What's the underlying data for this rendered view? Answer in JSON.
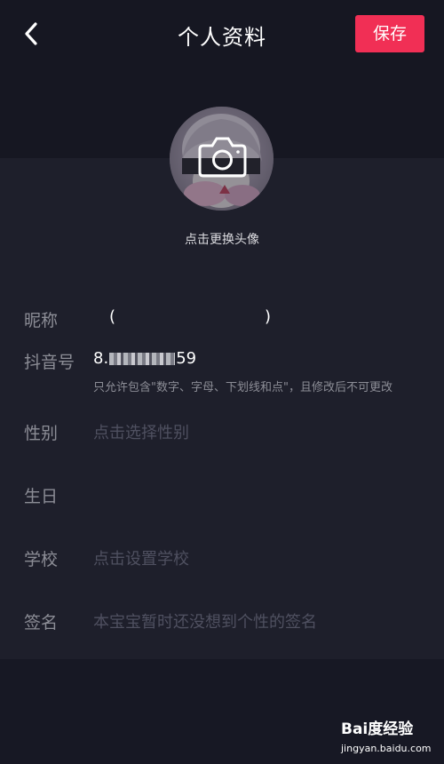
{
  "header": {
    "title": "个人资料",
    "save_label": "保存",
    "back_icon": "chevron-left-icon"
  },
  "avatar": {
    "hint": "点击更换头像",
    "icon": "camera-icon"
  },
  "fields": {
    "nickname": {
      "label": "昵称",
      "open": "(",
      "close": ")"
    },
    "douyin_id": {
      "label": "抖音号",
      "value_prefix": "8.",
      "value_suffix": "59",
      "hint": "只允许包含\"数字、字母、下划线和点\"，且修改后不可更改"
    },
    "gender": {
      "label": "性别",
      "placeholder": "点击选择性别"
    },
    "birthday": {
      "label": "生日"
    },
    "school": {
      "label": "学校",
      "placeholder": "点击设置学校"
    },
    "signature": {
      "label": "签名",
      "placeholder": "本宝宝暂时还没想到个性的签名"
    }
  },
  "watermark": {
    "logo_text": "Bai度经验",
    "url": "jingyan.baidu.com"
  },
  "colors": {
    "accent": "#f12f55",
    "background_top": "#161722",
    "background_panel": "#1e1f2b",
    "label": "#8c8d96",
    "placeholder": "#4f5060"
  }
}
